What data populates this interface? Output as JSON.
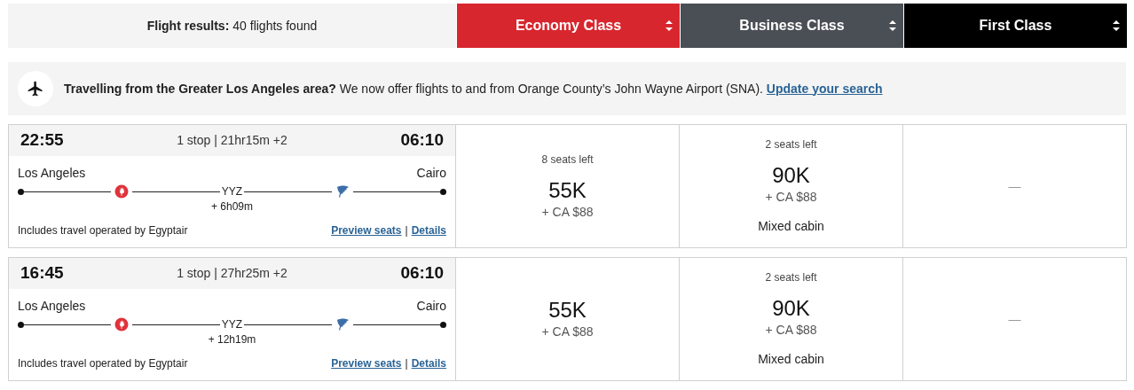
{
  "header": {
    "label": "Flight results:",
    "value": "40 flights found"
  },
  "cabins": [
    {
      "name": "Economy Class",
      "color": "#d8262e"
    },
    {
      "name": "Business Class",
      "color": "#4a4e55"
    },
    {
      "name": "First Class",
      "color": "#000000"
    }
  ],
  "banner": {
    "text": "**Travelling from the Greater Los Angeles area?** We now offer flights to and from Orange County’s John Wayne Airport (SNA).",
    "link": "Update your search"
  },
  "flights": [
    {
      "depart": "22:55",
      "summary": "1 stop | 21hr15m +2",
      "arrive": "06:10",
      "origin": "Los Angeles",
      "destination": "Cairo",
      "stop": "YYZ",
      "layover": "+ 6h09m",
      "operated": "Includes travel operated by Egyptair",
      "links": [
        "Preview seats",
        "Details"
      ],
      "separator": "|",
      "fares": [
        {
          "kind": "fare",
          "seats": "8 seats left",
          "points": "55K",
          "cash": "+ CA $88"
        },
        {
          "kind": "fare",
          "seats": "2 seats left",
          "points": "90K",
          "cash": "+ CA $88",
          "note": "Mixed cabin"
        },
        {
          "kind": "none",
          "text": "—"
        }
      ]
    },
    {
      "depart": "16:45",
      "summary": "1 stop | 27hr25m +2",
      "arrive": "06:10",
      "origin": "Los Angeles",
      "destination": "Cairo",
      "stop": "YYZ",
      "layover": "+ 12h19m",
      "operated": "Includes travel operated by Egyptair",
      "links": [
        "Preview seats",
        "Details"
      ],
      "separator": "|",
      "fares": [
        {
          "kind": "fare",
          "points": "55K",
          "cash": "+ CA $88"
        },
        {
          "kind": "fare",
          "seats": "2 seats left",
          "points": "90K",
          "cash": "+ CA $88",
          "note": "Mixed cabin"
        },
        {
          "kind": "none",
          "text": "—"
        }
      ]
    }
  ]
}
